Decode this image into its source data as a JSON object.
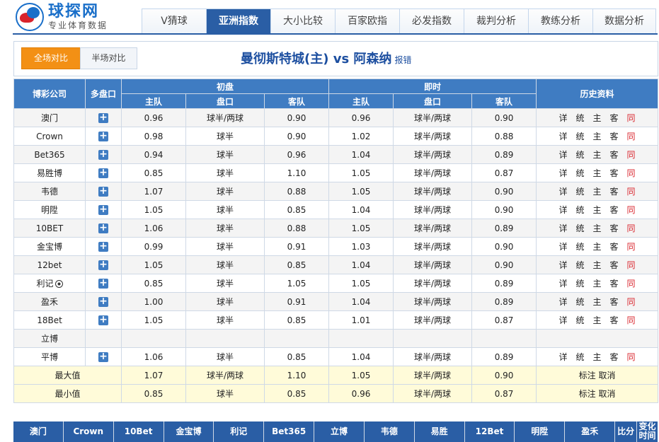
{
  "logo": {
    "title": "球探网",
    "subtitle": "专业体育数据"
  },
  "nav": [
    "V猜球",
    "亚洲指数",
    "大小比较",
    "百家欧指",
    "必发指数",
    "裁判分析",
    "教练分析",
    "数据分析"
  ],
  "tabs": {
    "full": "全场对比",
    "half": "半场对比"
  },
  "match": {
    "title": "曼彻斯特城(主) vs 阿森纳",
    "report": "报错"
  },
  "table": {
    "headers": {
      "company": "博彩公司",
      "multi": "多盘口",
      "initial": "初盘",
      "live": "即时",
      "history": "历史资料",
      "home": "主队",
      "line": "盘口",
      "away": "客队"
    },
    "rows": [
      {
        "company": "澳门",
        "plus": true,
        "i_home": "0.96",
        "i_line": "球半/两球",
        "i_away": "0.90",
        "l_home": "0.96",
        "l_line": "球半/两球",
        "l_away": "0.90",
        "hist": true
      },
      {
        "company": "Crown",
        "plus": true,
        "i_home": "0.98",
        "i_line": "球半",
        "i_away": "0.90",
        "l_home": "1.02",
        "l_line": "球半/两球",
        "l_away": "0.88",
        "hist": true
      },
      {
        "company": "Bet365",
        "plus": true,
        "i_home": "0.94",
        "i_line": "球半",
        "i_away": "0.96",
        "l_home": "1.04",
        "l_line": "球半/两球",
        "l_away": "0.89",
        "hist": true
      },
      {
        "company": "易胜博",
        "plus": true,
        "i_home": "0.85",
        "i_line": "球半",
        "i_away": "1.10",
        "l_home": "1.05",
        "l_line": "球半/两球",
        "l_away": "0.87",
        "hist": true
      },
      {
        "company": "韦德",
        "plus": true,
        "i_home": "1.07",
        "i_line": "球半",
        "i_away": "0.88",
        "l_home": "1.05",
        "l_line": "球半/两球",
        "l_away": "0.90",
        "hist": true
      },
      {
        "company": "明陞",
        "plus": true,
        "i_home": "1.05",
        "i_line": "球半",
        "i_away": "0.85",
        "l_home": "1.04",
        "l_line": "球半/两球",
        "l_away": "0.90",
        "hist": true
      },
      {
        "company": "10BET",
        "plus": true,
        "i_home": "1.06",
        "i_line": "球半",
        "i_away": "0.88",
        "l_home": "1.05",
        "l_line": "球半/两球",
        "l_away": "0.89",
        "hist": true
      },
      {
        "company": "金宝博",
        "plus": true,
        "i_home": "0.99",
        "i_line": "球半",
        "i_away": "0.91",
        "l_home": "1.03",
        "l_line": "球半/两球",
        "l_away": "0.90",
        "hist": true
      },
      {
        "company": "12bet",
        "plus": true,
        "i_home": "1.05",
        "i_line": "球半",
        "i_away": "0.85",
        "l_home": "1.04",
        "l_line": "球半/两球",
        "l_away": "0.90",
        "hist": true
      },
      {
        "company": "利记",
        "ball": true,
        "plus": true,
        "i_home": "0.85",
        "i_line": "球半",
        "i_away": "1.05",
        "l_home": "1.05",
        "l_line": "球半/两球",
        "l_away": "0.89",
        "hist": true
      },
      {
        "company": "盈禾",
        "plus": true,
        "i_home": "1.00",
        "i_line": "球半",
        "i_away": "0.91",
        "l_home": "1.04",
        "l_line": "球半/两球",
        "l_away": "0.89",
        "hist": true
      },
      {
        "company": "18Bet",
        "plus": true,
        "i_home": "1.05",
        "i_line": "球半",
        "i_away": "0.85",
        "l_home": "1.01",
        "l_line": "球半/两球",
        "l_away": "0.87",
        "hist": true
      },
      {
        "company": "立博",
        "plus": false,
        "i_home": "",
        "i_line": "",
        "i_away": "",
        "l_home": "",
        "l_line": "",
        "l_away": "",
        "hist": false
      },
      {
        "company": "平博",
        "plus": true,
        "i_home": "1.06",
        "i_line": "球半",
        "i_away": "0.85",
        "l_home": "1.04",
        "l_line": "球半/两球",
        "l_away": "0.89",
        "hist": true
      }
    ],
    "hist_links": [
      "详",
      "统",
      "主",
      "客",
      "同"
    ],
    "max": {
      "label": "最大值",
      "i_home": "1.07",
      "i_line": "球半/两球",
      "i_away": "1.10",
      "l_home": "1.05",
      "l_line": "球半/两球",
      "l_away": "0.90",
      "action": "标注 取消"
    },
    "min": {
      "label": "最小值",
      "i_home": "0.85",
      "i_line": "球半",
      "i_away": "0.85",
      "l_home": "0.96",
      "l_line": "球半/两球",
      "l_away": "0.87",
      "action": "标注 取消"
    }
  },
  "bottom": [
    "澳门",
    "Crown",
    "10Bet",
    "金宝博",
    "利记",
    "Bet365",
    "立博",
    "韦德",
    "易胜",
    "12Bet",
    "明陞",
    "盈禾",
    "比分",
    "变化时间"
  ],
  "colors": {
    "nav_active": "#2a5ea5",
    "header_blue": "#3f7cc2",
    "tab_orange": "#f39015",
    "link_red": "#d9232b"
  }
}
